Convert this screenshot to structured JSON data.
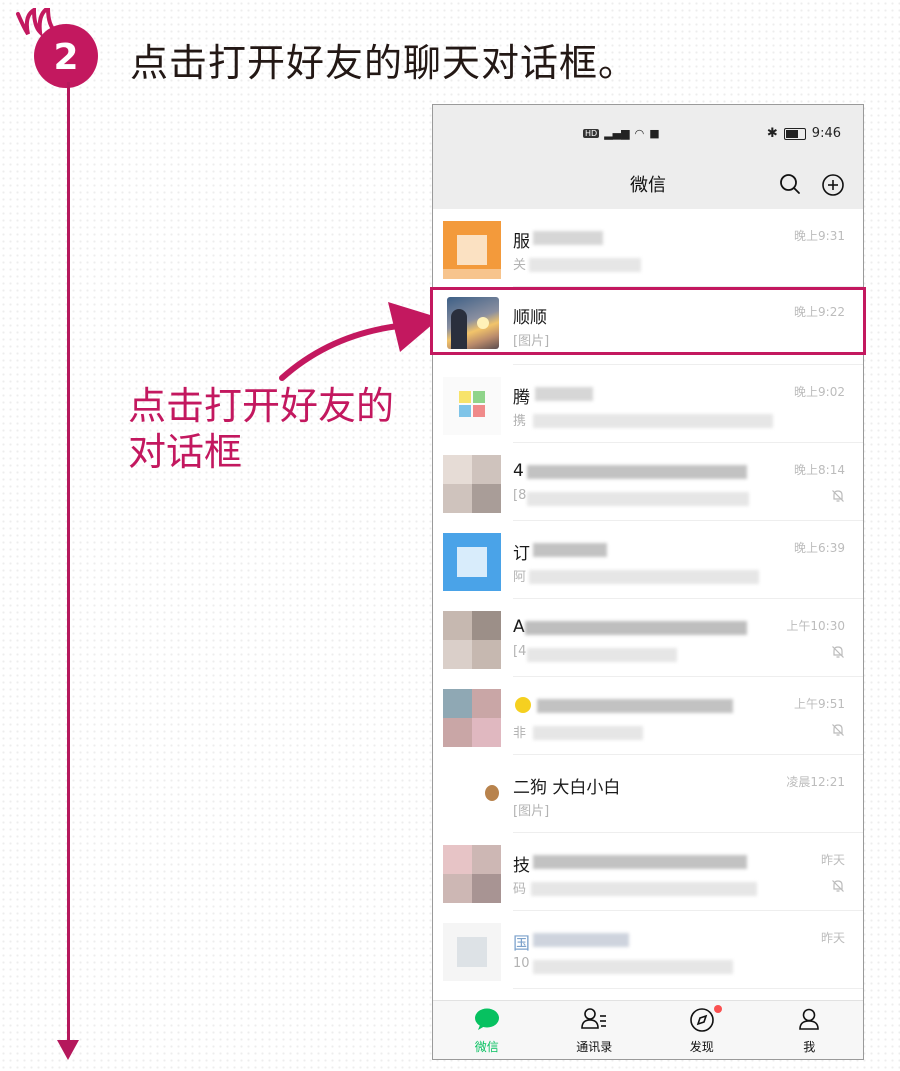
{
  "step": {
    "number": "2",
    "title": "点击打开好友的聊天对话框。"
  },
  "callout": {
    "line1": "点击打开好友的",
    "line2": "对话框"
  },
  "status_bar": {
    "time": "9:46"
  },
  "header": {
    "title": "微信"
  },
  "chats": [
    {
      "name": "服",
      "preview": "关",
      "time": "晚上9:31",
      "muted": false
    },
    {
      "name": "顺顺",
      "preview": "[图片]",
      "time": "晚上9:22",
      "muted": false
    },
    {
      "name": "腾",
      "preview": "携",
      "time": "晚上9:02",
      "muted": false
    },
    {
      "name": "4",
      "preview": "[8",
      "time": "晚上8:14",
      "muted": true
    },
    {
      "name": "订",
      "preview": "阿",
      "time": "晚上6:39",
      "muted": false
    },
    {
      "name": "A",
      "preview": "[4",
      "time": "上午10:30",
      "muted": true
    },
    {
      "name": "",
      "preview": "非",
      "time": "上午9:51",
      "muted": true
    },
    {
      "name": "二狗 大白小白",
      "preview": "[图片]",
      "time": "凌晨12:21",
      "muted": false
    },
    {
      "name": "技",
      "preview": "码",
      "time": "昨天",
      "muted": true
    },
    {
      "name": "国",
      "preview": "10",
      "time": "昨天",
      "muted": false
    }
  ],
  "tabs": [
    {
      "label": "微信",
      "icon": "chat-bubble-icon",
      "active": true
    },
    {
      "label": "通讯录",
      "icon": "contacts-icon",
      "active": false
    },
    {
      "label": "发现",
      "icon": "compass-icon",
      "active": false
    },
    {
      "label": "我",
      "icon": "person-icon",
      "active": false
    }
  ],
  "colors": {
    "accent": "#c3185f",
    "wechat_green": "#07c160",
    "badge_red": "#fa5151"
  }
}
